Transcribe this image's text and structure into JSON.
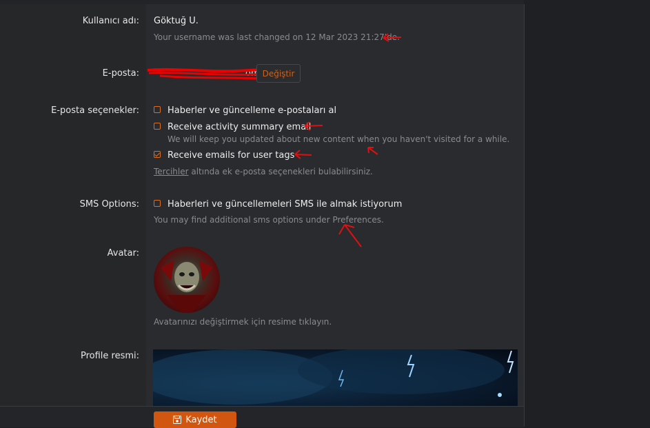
{
  "fields": {
    "username_label": "Kullanıcı adı:",
    "username_value": "Göktuğ U.",
    "username_note": "Your username was last changed on 12 Mar 2023 21:27'de.",
    "email_label": "E-posta:",
    "email_value_partial": "om",
    "change_button": "Değiştir",
    "email_options_label": "E-posta seçenekler:",
    "email_opt1": "Haberler ve güncelleme e-postaları al",
    "email_opt2": "Receive activity summary email",
    "email_opt2_hint": "We will keep you updated about new content when you haven't visited for a while.",
    "email_opt3": "Receive emails for user tags",
    "prefs_link": "Tercihler",
    "prefs_suffix": " altında ek e-posta seçenekleri bulabilirsiniz.",
    "sms_label": "SMS Options:",
    "sms_opt": "Haberleri ve güncellemeleri SMS ile almak istiyorum",
    "sms_hint_prefix": "You may find additional sms options under ",
    "sms_hint_link": "Preferences",
    "sms_hint_suffix": ".",
    "avatar_label": "Avatar:",
    "avatar_hint": "Avatarınızı değiştirmek için resime tıklayın.",
    "profile_image_label": "Profile resmi:",
    "save_button": "Kaydet"
  },
  "checkboxes": {
    "email_opt1_checked": false,
    "email_opt2_checked": false,
    "email_opt3_checked": true,
    "sms_opt_checked": false
  },
  "colors": {
    "accent": "#e06d1e",
    "save_bg": "#d1560f",
    "annotation_red": "#e01010"
  },
  "icons": {
    "save": "floppy-disk-icon",
    "checkbox": "checkbox-icon",
    "annotation": "red-arrow-icon"
  }
}
